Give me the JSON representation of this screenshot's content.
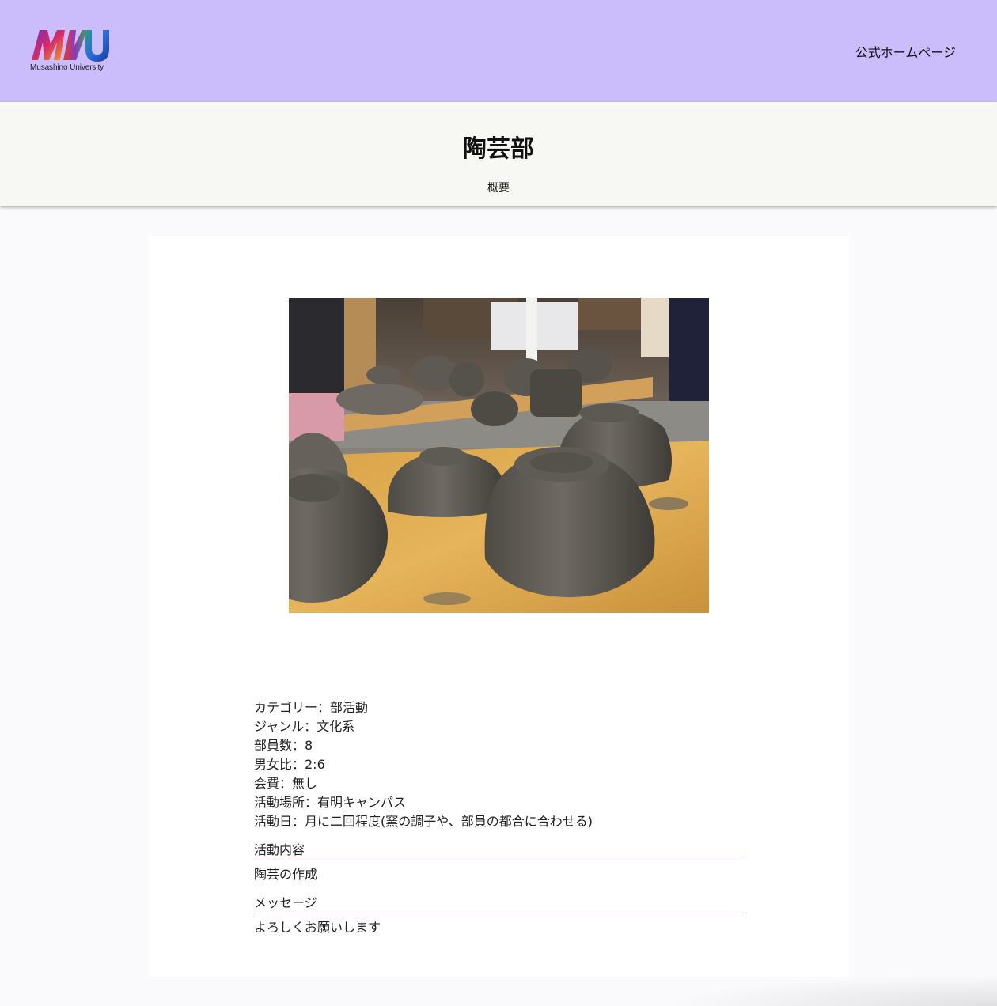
{
  "header": {
    "logo_text": "Musashino University",
    "home_link_label": "公式ホームページ"
  },
  "page": {
    "title": "陶芸部",
    "tab_overview": "概要"
  },
  "details": {
    "category": "カテゴリー：部活動",
    "genre": "ジャンル：文化系",
    "members": "部員数：8",
    "gender_ratio": "男女比：2:6",
    "fee": "会費：無し",
    "location": "活動場所：有明キャンパス",
    "schedule": "活動日：月に二回程度(窯の調子や、部員の都合に合わせる)"
  },
  "sections": {
    "activity_heading": "活動内容",
    "activity_body": "陶芸の作成",
    "message_heading": "メッセージ",
    "message_body": "よろしくお願いします"
  },
  "colors": {
    "header_bg": "#cbbcfc",
    "section_rule": "#b895d8"
  }
}
